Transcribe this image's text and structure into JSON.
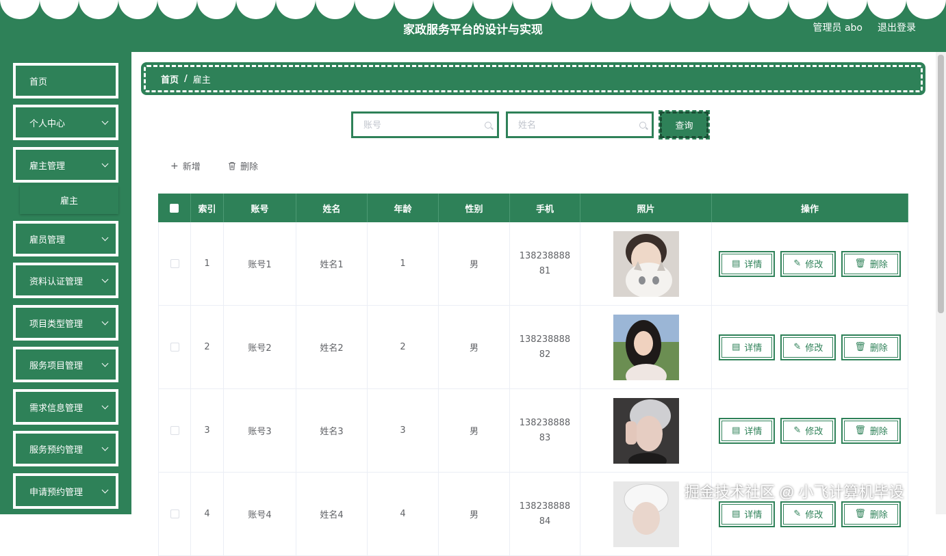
{
  "header": {
    "title": "家政服务平台的设计与实现",
    "user": "管理员 abo",
    "logout": "退出登录"
  },
  "sidebar": {
    "items": [
      {
        "label": "首页"
      },
      {
        "label": "个人中心"
      },
      {
        "label": "雇主管理"
      },
      {
        "label": "雇员管理"
      },
      {
        "label": "资料认证管理"
      },
      {
        "label": "项目类型管理"
      },
      {
        "label": "服务项目管理"
      },
      {
        "label": "需求信息管理"
      },
      {
        "label": "服务预约管理"
      },
      {
        "label": "申请预约管理"
      }
    ],
    "sub_item": "雇主"
  },
  "breadcrumb": {
    "home": "首页",
    "sep": "/",
    "current": "雇主"
  },
  "search": {
    "account_placeholder": "账号",
    "name_placeholder": "姓名",
    "query_label": "查询"
  },
  "actions": {
    "add": "新增",
    "delete": "删除"
  },
  "table": {
    "headers": [
      "索引",
      "账号",
      "姓名",
      "年龄",
      "性别",
      "手机",
      "照片",
      "操作"
    ],
    "rows": [
      {
        "index": "1",
        "account": "账号1",
        "name": "姓名1",
        "age": "1",
        "sex": "男",
        "phone": "13823888881"
      },
      {
        "index": "2",
        "account": "账号2",
        "name": "姓名2",
        "age": "2",
        "sex": "男",
        "phone": "13823888882"
      },
      {
        "index": "3",
        "account": "账号3",
        "name": "姓名3",
        "age": "3",
        "sex": "男",
        "phone": "13823888883"
      },
      {
        "index": "4",
        "account": "账号4",
        "name": "姓名4",
        "age": "4",
        "sex": "男",
        "phone": "13823888884"
      }
    ],
    "ops": {
      "detail": "详情",
      "edit": "修改",
      "delete": "删除"
    }
  },
  "watermark": "掘金技术社区 @ 小飞计算机毕设",
  "colors": {
    "primary": "#2e8158",
    "white": "#ffffff"
  }
}
